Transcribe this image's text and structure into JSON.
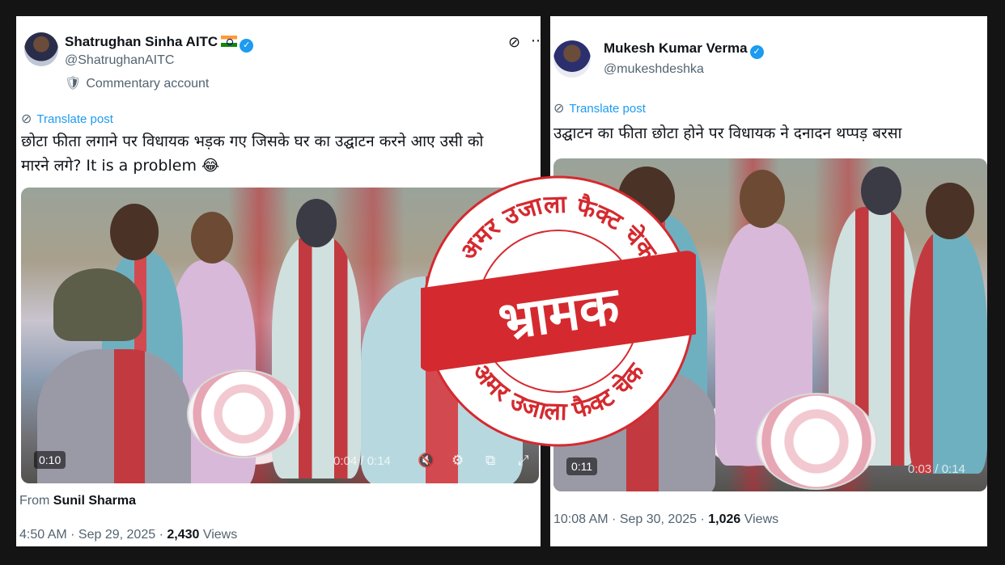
{
  "left_post": {
    "author_name": "Shatrughan Sinha AITC",
    "handle": "@ShatrughanAITC",
    "account_label": "Commentary account",
    "translate_label": "Translate post",
    "text_line1": "छोटा फीता लगाने पर विधायक भड़क गए जिसके घर का उद्घाटन करने आए उसी को",
    "text_line2": "मारने लगे? It is a problem 😂",
    "video": {
      "elapsed_badge": "0:10",
      "progress": "0:04 / 0:14"
    },
    "from_label": "From",
    "from_name": "Sunil Sharma",
    "timestamp": "4:50 AM · Sep 29, 2025 · ",
    "views_count": "2,430",
    "views_label": " Views"
  },
  "right_post": {
    "author_name": "Mukesh Kumar Verma",
    "handle": "@mukeshdeshka",
    "translate_label": "Translate post",
    "text_line1": "उद्घाटन का फीता छोटा होने पर विधायक ने दनादन थप्पड़ बरसा",
    "video": {
      "elapsed_badge": "0:11",
      "progress": "0:03 / 0:14"
    },
    "timestamp": "10:08 AM · Sep 30, 2025 · ",
    "views_count": "1,026",
    "views_label": " Views"
  },
  "stamp": {
    "top_arc": "अमर उजाला फैक्ट चेक",
    "bottom_arc": "अमर उजाला फैक्ट चेक",
    "verdict": "भ्रामक",
    "color": "#d42a2f"
  }
}
